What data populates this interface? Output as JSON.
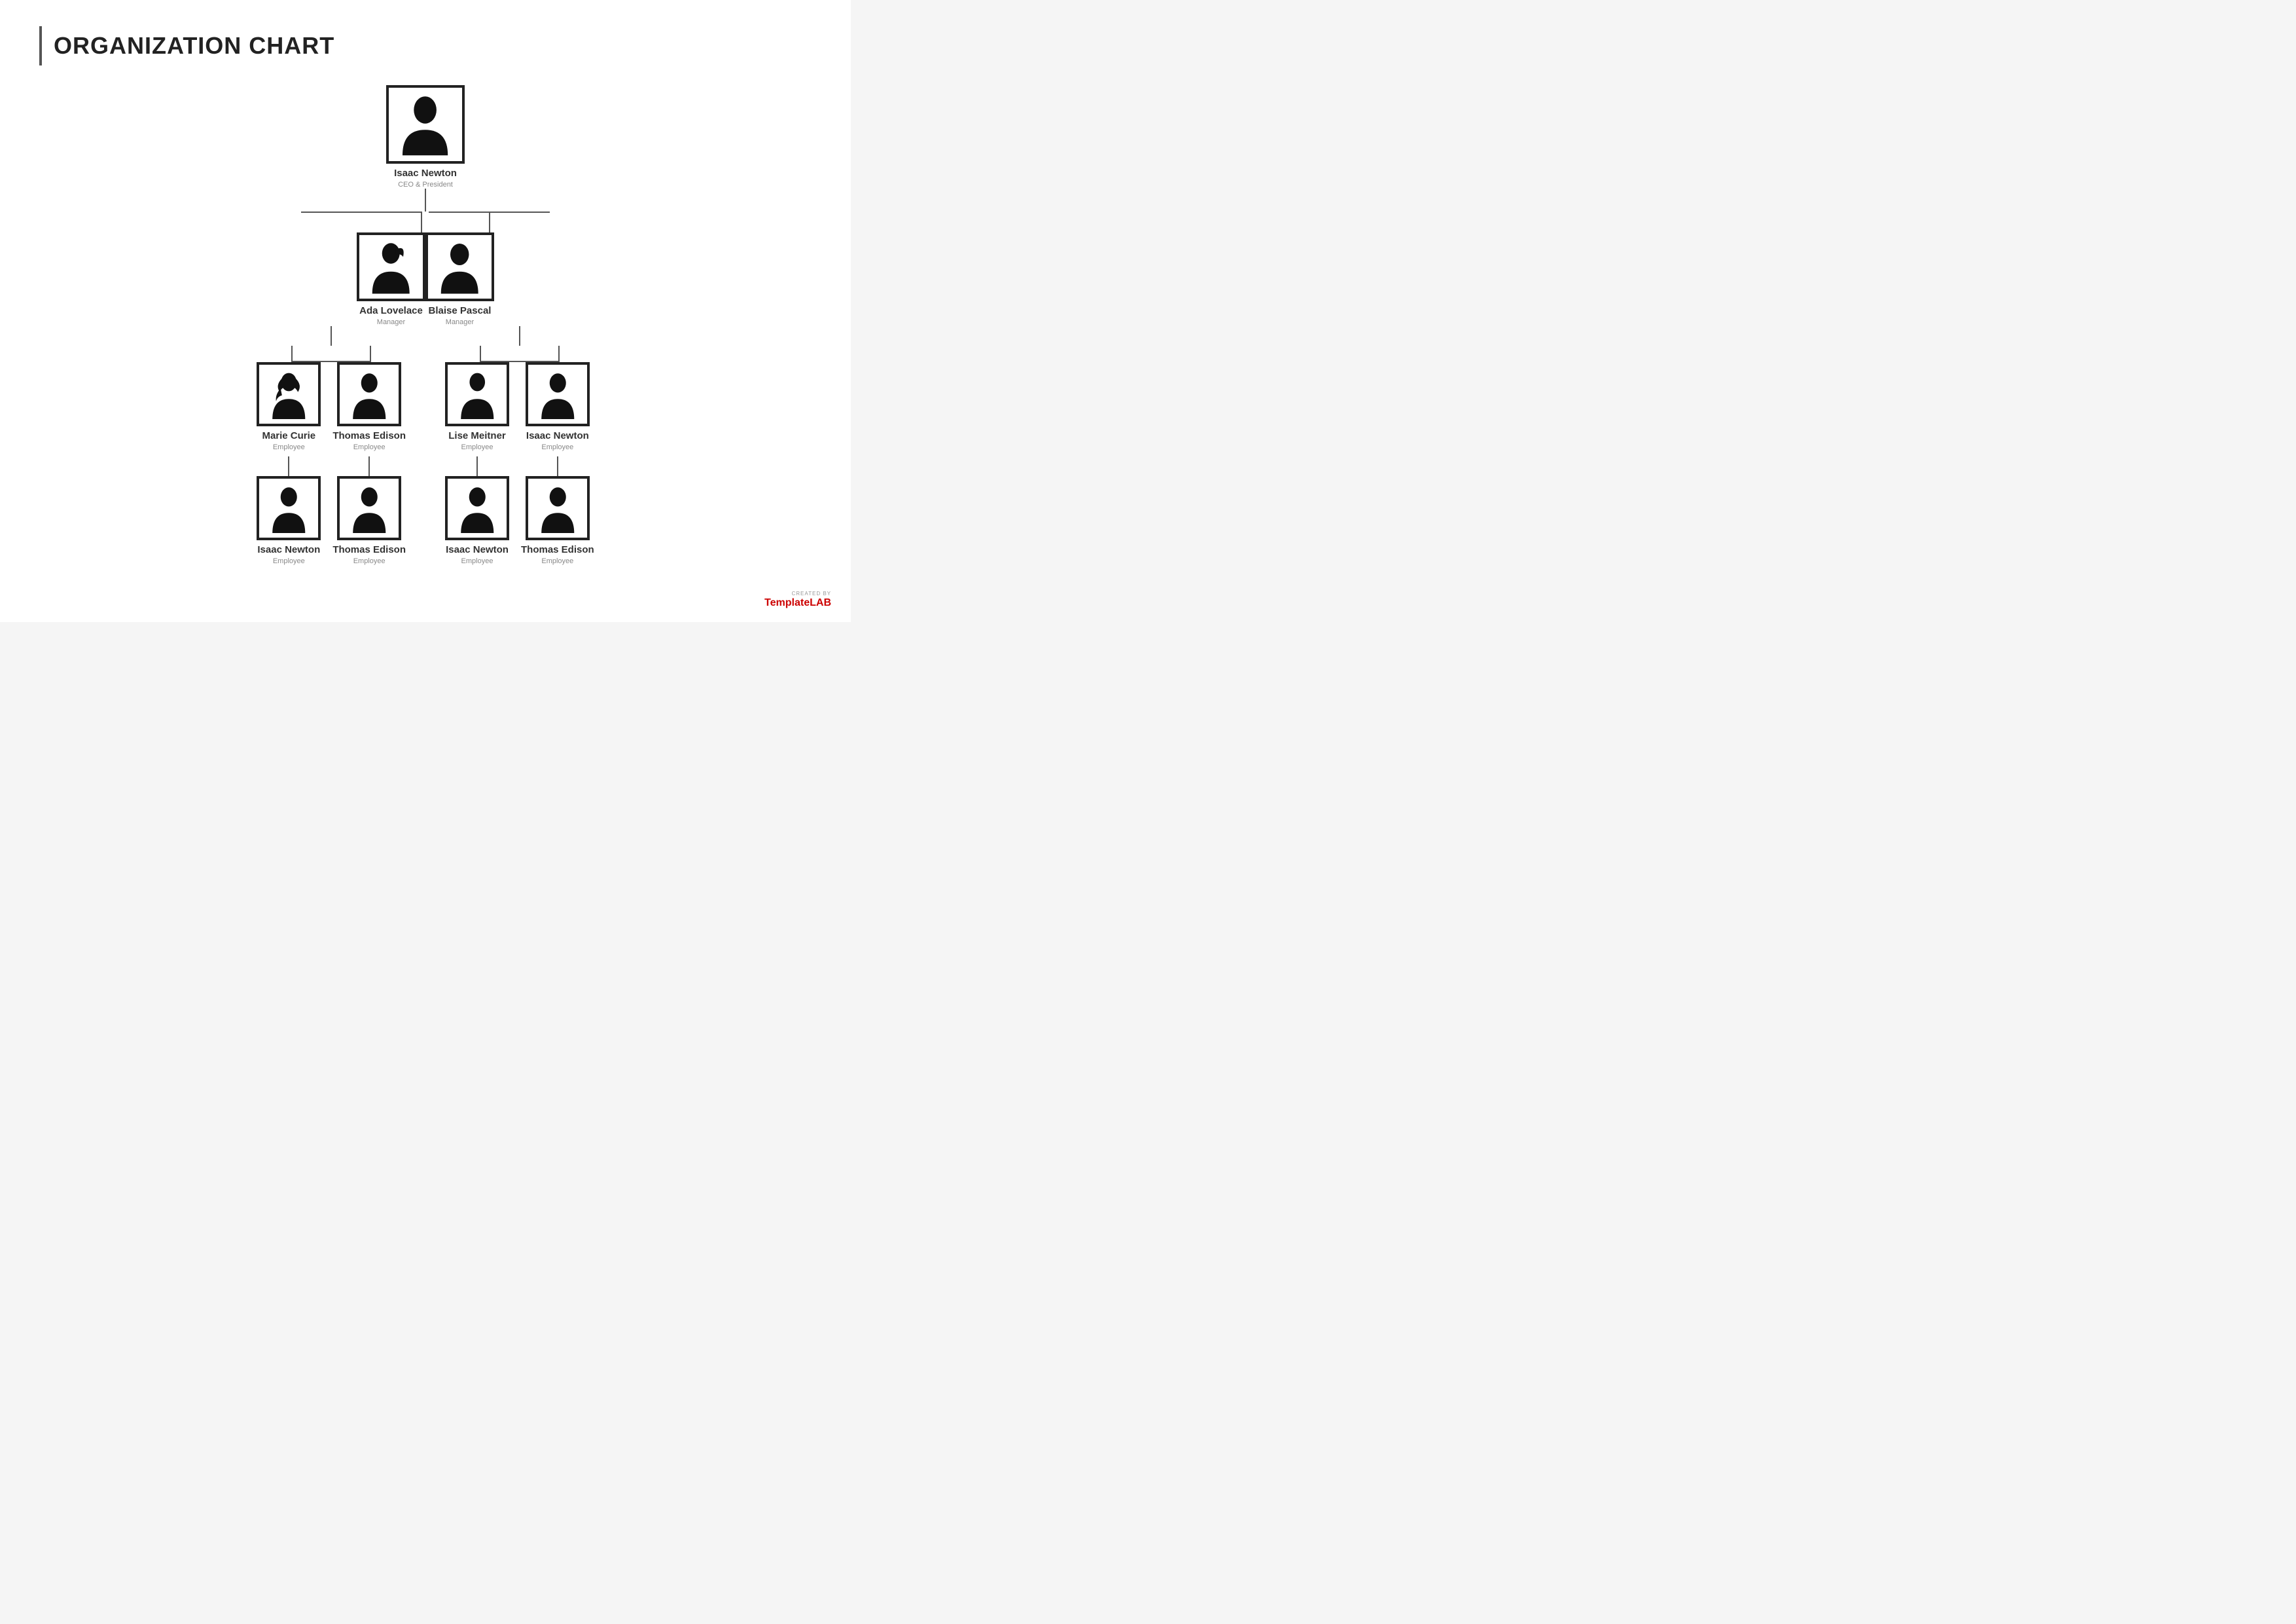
{
  "page": {
    "title": "ORGANIZATION CHART",
    "background": "#ffffff"
  },
  "logo": {
    "created_by": "CREATED BY",
    "brand_plain": "Template",
    "brand_accent": "LAB"
  },
  "chart": {
    "level1": {
      "name": "Isaac Newton",
      "role": "CEO & President"
    },
    "level2": [
      {
        "name": "Ada Lovelace",
        "role": "Manager",
        "gender": "female"
      },
      {
        "name": "Blaise Pascal",
        "role": "Manager",
        "gender": "male"
      }
    ],
    "level3": [
      [
        {
          "name": "Marie Curie",
          "role": "Employee",
          "gender": "female"
        },
        {
          "name": "Thomas Edison",
          "role": "Employee",
          "gender": "male"
        }
      ],
      [
        {
          "name": "Lise Meitner",
          "role": "Employee",
          "gender": "female"
        },
        {
          "name": "Isaac Newton",
          "role": "Employee",
          "gender": "male"
        }
      ]
    ],
    "level4": [
      [
        {
          "name": "Isaac Newton",
          "role": "Employee",
          "gender": "male"
        },
        {
          "name": "Thomas Edison",
          "role": "Employee",
          "gender": "male2"
        }
      ],
      [
        {
          "name": "Isaac Newton",
          "role": "Employee",
          "gender": "male3"
        },
        {
          "name": "Thomas Edison",
          "role": "Employee",
          "gender": "male4"
        }
      ]
    ]
  }
}
